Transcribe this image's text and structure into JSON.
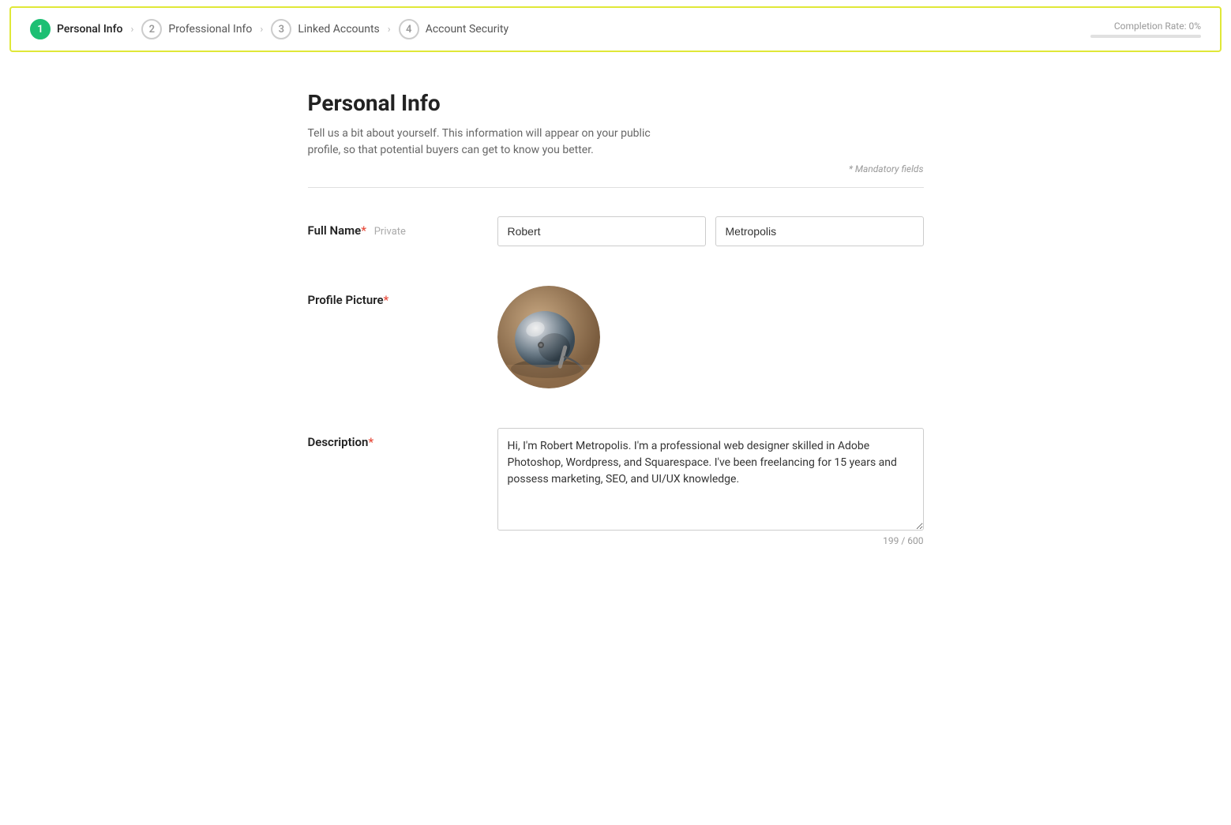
{
  "topNav": {
    "steps": [
      {
        "number": "1",
        "label": "Personal Info",
        "active": true
      },
      {
        "number": "2",
        "label": "Professional Info",
        "active": false
      },
      {
        "number": "3",
        "label": "Linked Accounts",
        "active": false
      },
      {
        "number": "4",
        "label": "Account Security",
        "active": false
      }
    ]
  },
  "completion": {
    "label": "Completion Rate: 0%",
    "percent": 0
  },
  "form": {
    "pageTitle": "Personal Info",
    "pageDescription": "Tell us a bit about yourself. This information will appear on your public profile, so that potential buyers can get to know you better.",
    "mandatoryNote": "* Mandatory fields",
    "fields": {
      "fullName": {
        "label": "Full Name",
        "privateTag": "Private",
        "firstName": "Robert",
        "lastName": "Metropolis"
      },
      "profilePicture": {
        "label": "Profile Picture"
      },
      "description": {
        "label": "Description",
        "value": "Hi, I'm Robert Metropolis. I'm a professional web designer skilled in Adobe Photoshop, Wordpress, and Squarespace. I've been freelancing for 15 years and possess marketing, SEO, and UI/UX knowledge.",
        "charCount": "199 / 600"
      }
    }
  }
}
